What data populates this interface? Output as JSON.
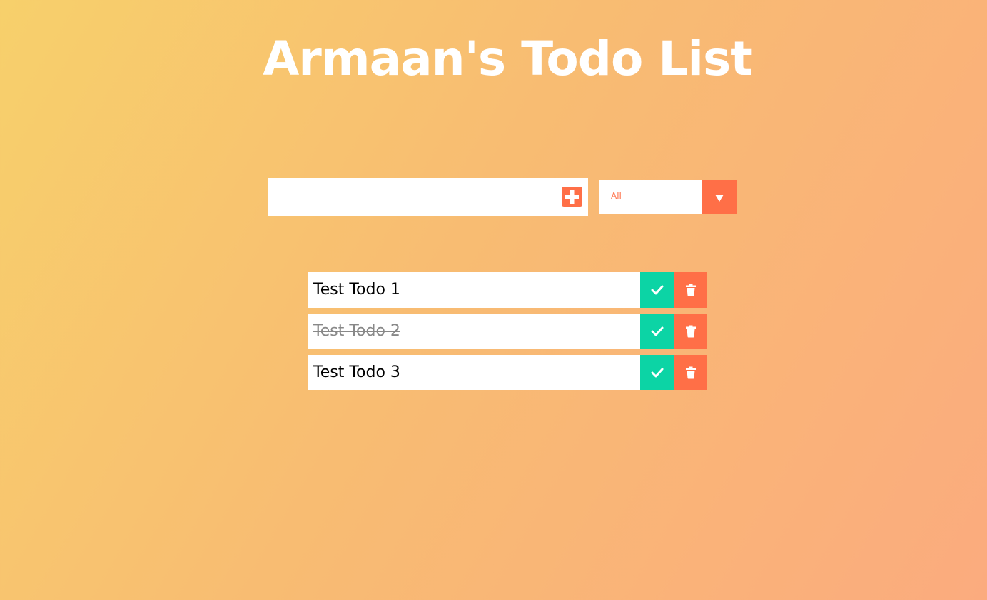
{
  "header": {
    "title": "Armaan's Todo List"
  },
  "form": {
    "input_value": "",
    "add_icon": "plus-icon",
    "filter": {
      "selected": "All",
      "arrow_icon": "caret-down-icon"
    }
  },
  "todos": [
    {
      "text": "Test Todo 1",
      "completed": false
    },
    {
      "text": "Test Todo 2",
      "completed": true
    },
    {
      "text": "Test Todo 3",
      "completed": false
    }
  ],
  "icons": {
    "complete": "check-icon",
    "delete": "trash-icon"
  },
  "colors": {
    "accent": "#ff6f47",
    "complete": "#0cd4a5",
    "gradient_start": "#f7d06b",
    "gradient_end": "#fbab7e",
    "title": "#ffffff"
  }
}
